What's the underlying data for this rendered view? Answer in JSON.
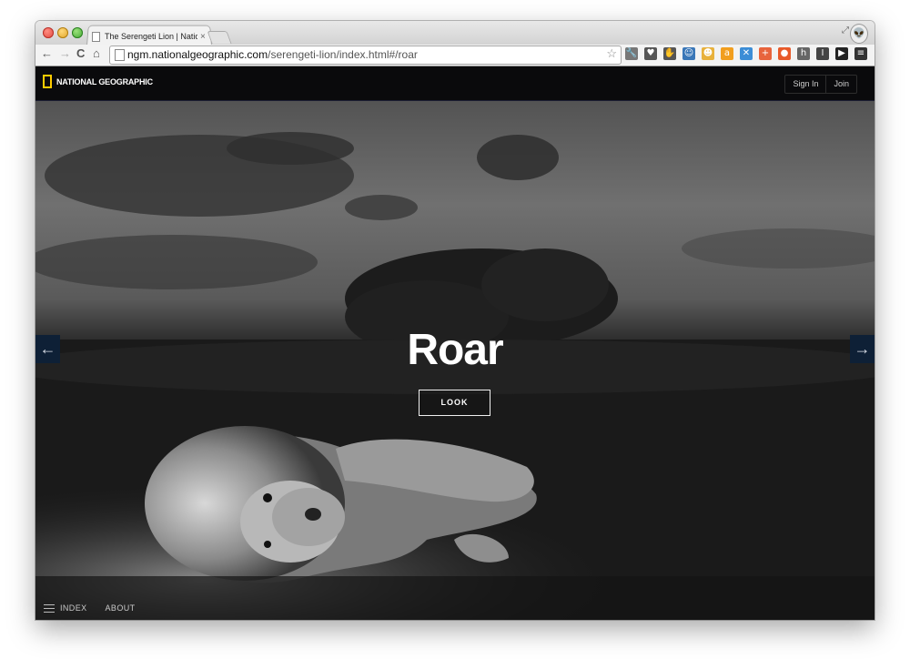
{
  "browser": {
    "tab_title": "The Serengeti Lion | Nation",
    "tab_close": "×",
    "url_host": "ngm.nationalgeographic.com",
    "url_path": "/serengeti-lion/index.html#/roar",
    "nav": {
      "back": "←",
      "forward": "→",
      "reload": "C",
      "home": "⌂"
    },
    "bookmark_star": "☆",
    "extensions": [
      {
        "name": "wrench-icon",
        "glyph": "🔧",
        "color": "#777777"
      },
      {
        "name": "pocket-icon",
        "glyph": "♥",
        "color": "#555555"
      },
      {
        "name": "hand-icon",
        "glyph": "✋",
        "color": "#555555"
      },
      {
        "name": "face-extension-icon",
        "glyph": "☺",
        "color": "#3a77b8"
      },
      {
        "name": "smile-extension-icon",
        "glyph": "☻",
        "color": "#e8b13c"
      },
      {
        "name": "amazon-icon",
        "glyph": "a",
        "color": "#f19e1f"
      },
      {
        "name": "x-extension-icon",
        "glyph": "✕",
        "color": "#3c8dd6"
      },
      {
        "name": "plus-extension-icon",
        "glyph": "+",
        "color": "#e8643c"
      },
      {
        "name": "orange-extension-icon",
        "glyph": "●",
        "color": "#e85a2a"
      },
      {
        "name": "h-extension-icon",
        "glyph": "h",
        "color": "#666666"
      },
      {
        "name": "i-extension-icon",
        "glyph": "I",
        "color": "#444444"
      },
      {
        "name": "play-extension-icon",
        "glyph": "▶",
        "color": "#222222"
      },
      {
        "name": "menu-icon",
        "glyph": "≡",
        "color": "#333333"
      }
    ]
  },
  "site": {
    "logo_text": "NATIONAL GEOGRAPHIC",
    "sign_in": "Sign In",
    "join": "Join",
    "colors": {
      "brand_yellow": "#ffcc00",
      "arrow_bg": "#0e2036"
    }
  },
  "hero": {
    "title": "Roar",
    "look_label": "LOOK",
    "prev_arrow": "←",
    "next_arrow": "→"
  },
  "footer": {
    "index_label": "INDEX",
    "about_label": "ABOUT"
  }
}
